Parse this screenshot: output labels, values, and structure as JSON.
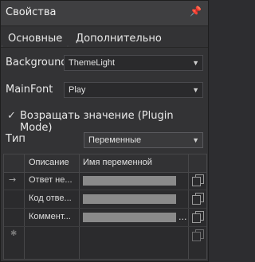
{
  "panel": {
    "title": "Свойства",
    "pin_icon": "pin-icon"
  },
  "tabs": [
    {
      "label": "Основные",
      "active": true
    },
    {
      "label": "Дополнительно",
      "active": false
    }
  ],
  "fields": {
    "background": {
      "label": "Background",
      "value": "ThemeLight"
    },
    "mainfont": {
      "label": "MainFont",
      "value": "Play"
    }
  },
  "checkbox": {
    "label": "Возращать значение (Plugin Mode)",
    "checked": true
  },
  "type": {
    "label": "Тип",
    "value": "Переменные"
  },
  "grid": {
    "headers": {
      "description": "Описание",
      "variable": "Имя переменной"
    },
    "rows": [
      {
        "description": "Ответ не...",
        "indicator": "→"
      },
      {
        "description": "Код отве...",
        "indicator": ""
      },
      {
        "description": "Коммент...",
        "indicator": "",
        "ellipsis": "..."
      }
    ],
    "new_row_indicator": "✱"
  }
}
